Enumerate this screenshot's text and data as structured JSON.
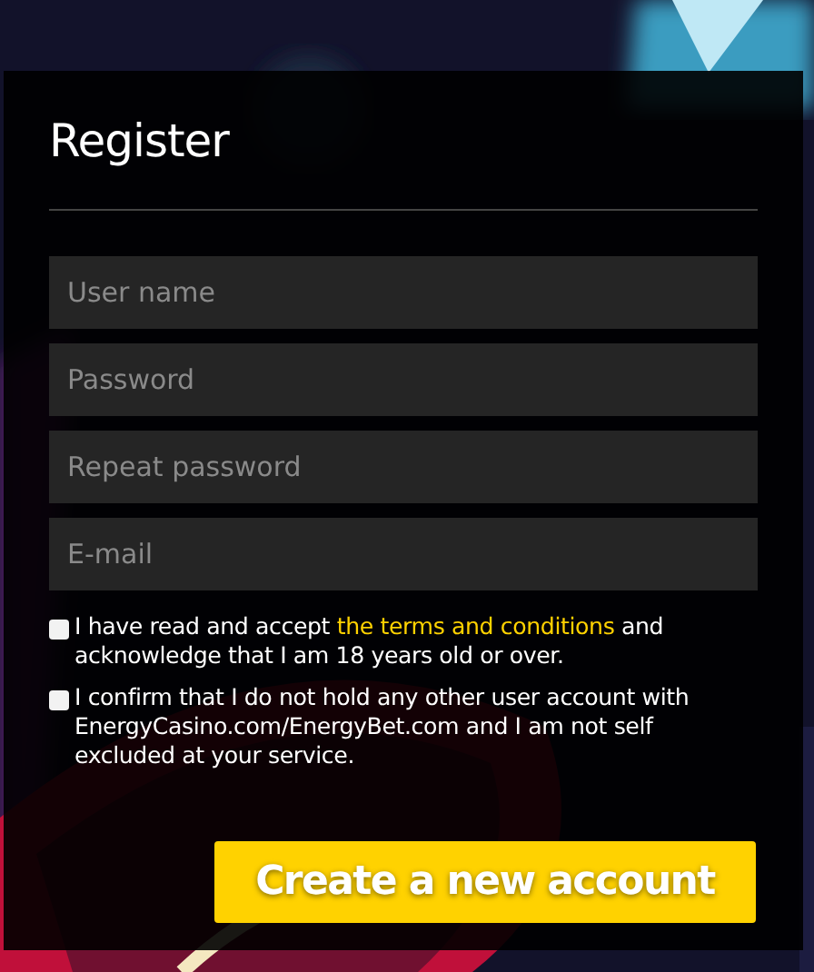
{
  "title": "Register",
  "fields": [
    {
      "placeholder": "User name"
    },
    {
      "placeholder": "Password"
    },
    {
      "placeholder": "Repeat password"
    },
    {
      "placeholder": "E-mail"
    }
  ],
  "agreements": [
    {
      "checked": false,
      "text_before": "I have read and accept ",
      "link": "the terms and conditions",
      "text_after": " and acknowledge that I am 18 years old or over."
    },
    {
      "checked": false,
      "text_before": " I confirm that I do not hold any other user account with EnergyCasino.com/EnergyBet.com and I am not self excluded at your service."
    }
  ],
  "submit_button": "Create a new account"
}
